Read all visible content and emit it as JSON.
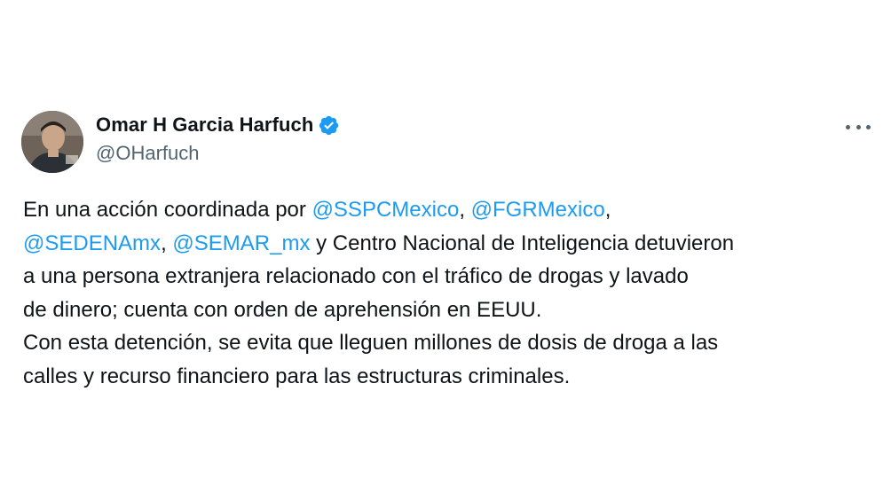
{
  "author": {
    "display_name": "Omar H Garcia Harfuch",
    "handle": "@OHarfuch",
    "verified": true,
    "avatar_icon": "profile-photo",
    "verified_icon": "verified-badge-icon",
    "verified_color": "#1d9bf0"
  },
  "more_icon": "more-horizontal-icon",
  "tweet": {
    "lines": [
      [
        {
          "text": "En una acción coordinada por ",
          "mention": false
        },
        {
          "text": "@SSPCMexico",
          "mention": true
        },
        {
          "text": ", ",
          "mention": false
        },
        {
          "text": "@FGRMexico",
          "mention": true
        },
        {
          "text": ",",
          "mention": false
        }
      ],
      [
        {
          "text": "@SEDENAmx",
          "mention": true
        },
        {
          "text": ", ",
          "mention": false
        },
        {
          "text": "@SEMAR_mx",
          "mention": true
        },
        {
          "text": " y Centro Nacional de Inteligencia detuvieron",
          "mention": false
        }
      ],
      [
        {
          "text": "a una persona extranjera relacionado con el tráfico de drogas y lavado",
          "mention": false
        }
      ],
      [
        {
          "text": "de dinero; cuenta con orden de aprehensión en EEUU.",
          "mention": false
        }
      ],
      [
        {
          "text": "Con esta detención, se evita que lleguen millones de dosis de droga a las",
          "mention": false
        }
      ],
      [
        {
          "text": "calles y recurso financiero para las estructuras criminales.",
          "mention": false
        }
      ]
    ]
  },
  "colors": {
    "text": "#0f1419",
    "secondary": "#536471",
    "link": "#1d9bf0",
    "background": "#ffffff"
  }
}
